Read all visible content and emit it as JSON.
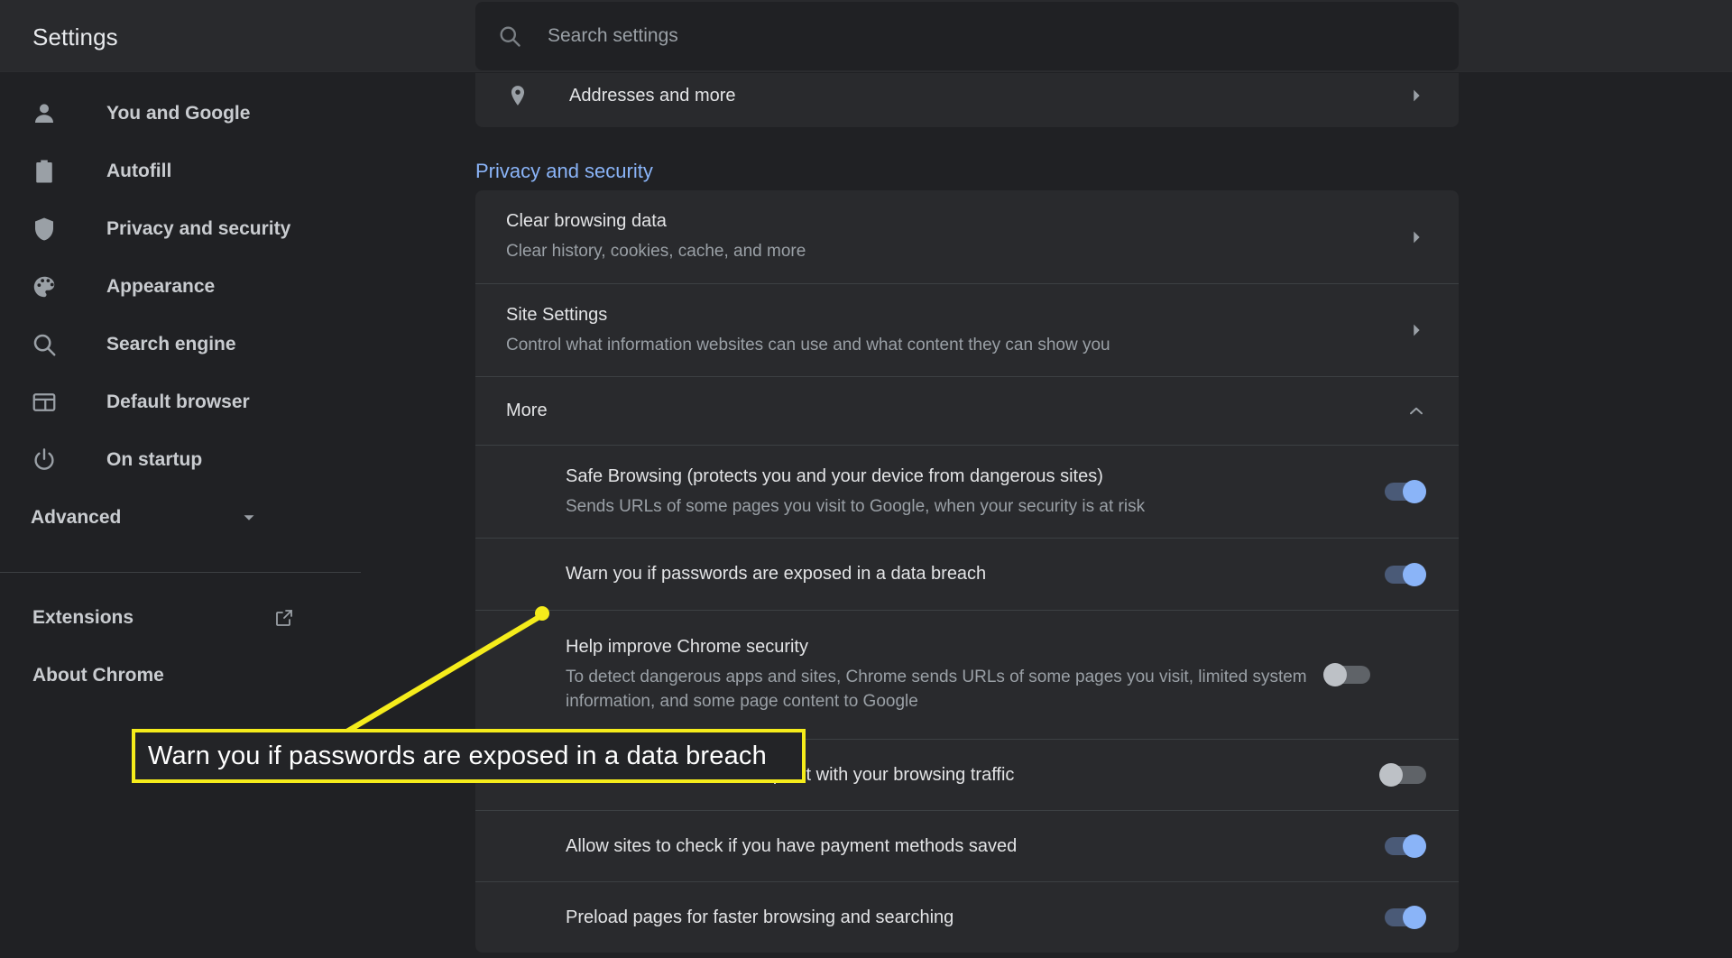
{
  "app": {
    "title": "Settings"
  },
  "search": {
    "placeholder": "Search settings",
    "value": "",
    "icon": "search-icon"
  },
  "sidebar": {
    "items": [
      {
        "label": "You and Google",
        "icon": "person-icon"
      },
      {
        "label": "Autofill",
        "icon": "clipboard-icon"
      },
      {
        "label": "Privacy and security",
        "icon": "shield-icon"
      },
      {
        "label": "Appearance",
        "icon": "palette-icon"
      },
      {
        "label": "Search engine",
        "icon": "magnifier-icon"
      },
      {
        "label": "Default browser",
        "icon": "browser-window-icon"
      },
      {
        "label": "On startup",
        "icon": "power-icon"
      }
    ],
    "advanced": {
      "label": "Advanced",
      "icon": "chevron-down-icon"
    },
    "footer": [
      {
        "label": "Extensions",
        "icon": "external-link-icon"
      },
      {
        "label": "About Chrome",
        "icon": ""
      }
    ]
  },
  "main": {
    "top_card": {
      "title": "Addresses and more",
      "icon": "location-pin-icon",
      "chevron": "chevron-right-icon"
    },
    "section_title": "Privacy and security",
    "privacy_rows": [
      {
        "title": "Clear browsing data",
        "sub": "Clear history, cookies, cache, and more",
        "chevron": "chevron-right-icon"
      },
      {
        "title": "Site Settings",
        "sub": "Control what information websites can use and what content they can show you",
        "chevron": "chevron-right-icon"
      },
      {
        "title": "More",
        "sub": "",
        "chevron": "chevron-up-icon"
      }
    ],
    "more_rows": [
      {
        "title": "Safe Browsing (protects you and your device from dangerous sites)",
        "sub": "Sends URLs of some pages you visit to Google, when your security is at risk",
        "toggle": "on"
      },
      {
        "title": "Warn you if passwords are exposed in a data breach",
        "sub": "",
        "toggle": "on"
      },
      {
        "title": "Help improve Chrome security",
        "sub": "To detect dangerous apps and sites, Chrome sends URLs of some pages you visit, limited system information, and some page content to Google",
        "toggle": "off"
      },
      {
        "title": "Send a \"Do Not Track\" request with your browsing traffic",
        "sub": "",
        "toggle": "off"
      },
      {
        "title": "Allow sites to check if you have payment methods saved",
        "sub": "",
        "toggle": "on"
      },
      {
        "title": "Preload pages for faster browsing and searching",
        "sub": "",
        "toggle": "on"
      }
    ]
  },
  "annotation": {
    "callout_text": "Warn you if passwords are exposed in a data breach",
    "color": "#f5ec1b",
    "target": "Warn you if passwords are exposed in a data breach"
  }
}
